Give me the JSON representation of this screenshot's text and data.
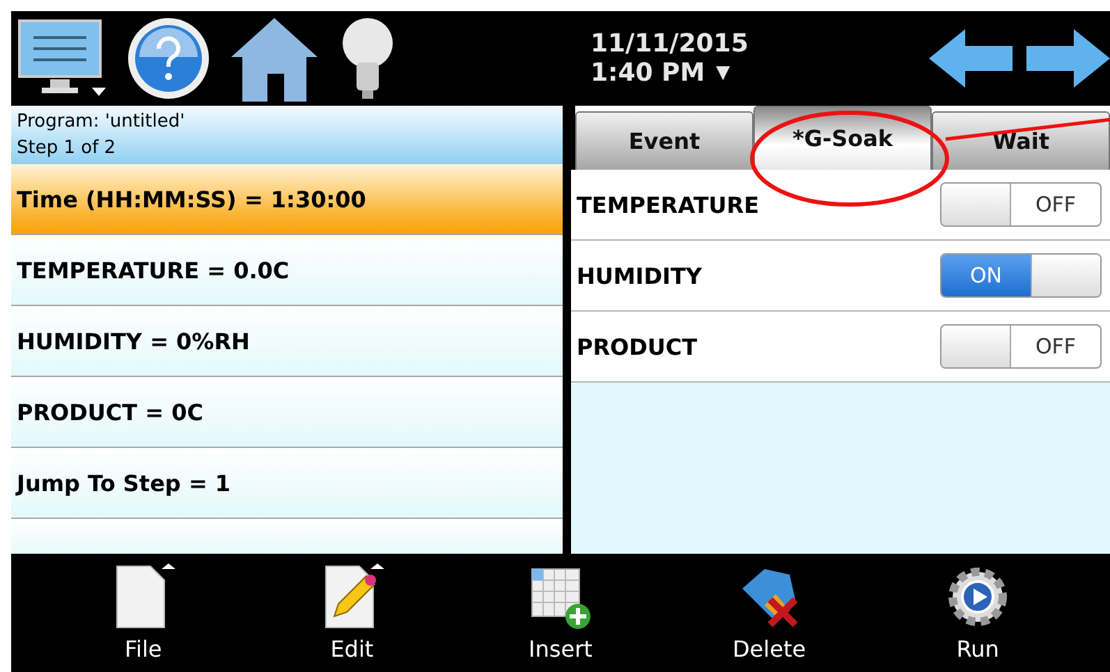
{
  "header": {
    "date": "11/11/2015",
    "time": "1:40 PM",
    "time_menu": "▼"
  },
  "program": {
    "name": "Program: 'untitled'",
    "step": "Step 1 of 2"
  },
  "steps": [
    {
      "label": "Time (HH:MM:SS) = 1:30:00",
      "selected": true
    },
    {
      "label": "TEMPERATURE = 0.0C",
      "selected": false
    },
    {
      "label": "HUMIDITY = 0%RH",
      "selected": false
    },
    {
      "label": "PRODUCT = 0C",
      "selected": false
    },
    {
      "label": "Jump To Step = 1",
      "selected": false
    }
  ],
  "tabs": [
    {
      "label": "Event",
      "selected": false
    },
    {
      "label": "*G-Soak",
      "selected": true
    },
    {
      "label": "Wait",
      "selected": false
    }
  ],
  "soaks": [
    {
      "label": "TEMPERATURE",
      "on": false,
      "state_text": "OFF"
    },
    {
      "label": "HUMIDITY",
      "on": true,
      "state_text": "ON"
    },
    {
      "label": "PRODUCT",
      "on": false,
      "state_text": "OFF"
    }
  ],
  "toolbar": [
    {
      "kind": "file",
      "label": "File"
    },
    {
      "kind": "edit",
      "label": "Edit"
    },
    {
      "kind": "insert",
      "label": "Insert"
    },
    {
      "kind": "delete",
      "label": "Delete"
    },
    {
      "kind": "run",
      "label": "Run"
    }
  ]
}
